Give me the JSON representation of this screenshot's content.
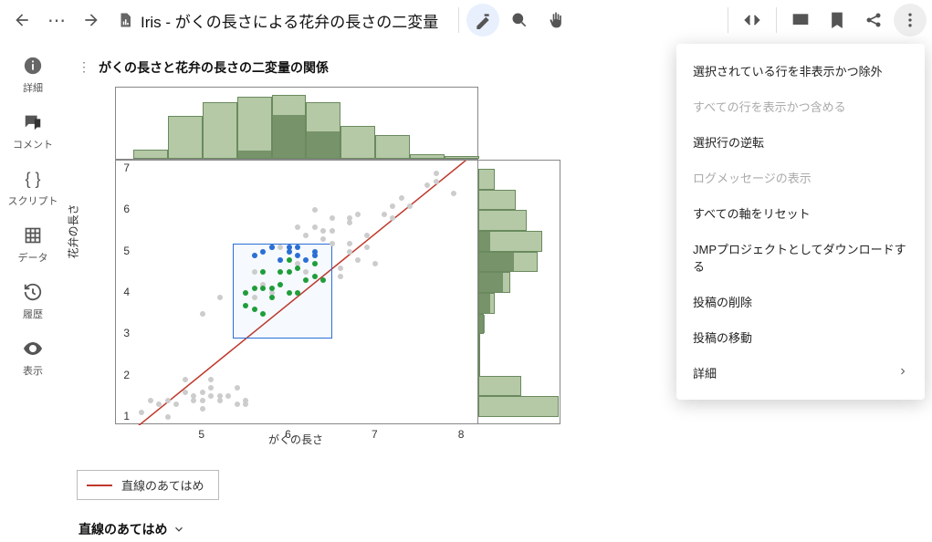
{
  "header": {
    "doc_title": "Iris - がくの長さによる花弁の長さの二変量"
  },
  "sidebar": {
    "items": [
      {
        "label": "詳細"
      },
      {
        "label": "コメント"
      },
      {
        "label": "スクリプト"
      },
      {
        "label": "データ"
      },
      {
        "label": "履歴"
      },
      {
        "label": "表示"
      }
    ]
  },
  "panel": {
    "title": "がくの長さと花弁の長さの二変量の関係",
    "y_label": "花弁の長さ",
    "x_label": "がくの長さ",
    "legend": "直線のあてはめ",
    "fit_section": "直線のあてはめ"
  },
  "menu": {
    "items": [
      {
        "label": "選択されている行を非表示かつ除外",
        "disabled": false
      },
      {
        "label": "すべての行を表示かつ含める",
        "disabled": true
      },
      {
        "label": "選択行の逆転",
        "disabled": false
      },
      {
        "label": "ログメッセージの表示",
        "disabled": true
      },
      {
        "label": "すべての軸をリセット",
        "disabled": false
      },
      {
        "label": "JMPプロジェクトとしてダウンロードする",
        "disabled": false
      },
      {
        "label": "投稿の削除",
        "disabled": false
      },
      {
        "label": "投稿の移動",
        "disabled": false
      },
      {
        "label": "詳細",
        "disabled": false,
        "chevron": true
      }
    ]
  },
  "chart_data": {
    "type": "scatter",
    "title": "がくの長さと花弁の長さの二変量の関係",
    "xlabel": "がくの長さ",
    "ylabel": "花弁の長さ",
    "xlim": [
      4,
      8.2
    ],
    "ylim": [
      0.8,
      7.2
    ],
    "xticks": [
      5,
      6,
      7,
      8
    ],
    "yticks": [
      1,
      2,
      3,
      4,
      5,
      6,
      7
    ],
    "fit_line": {
      "x1": 4.15,
      "y1": 0.6,
      "x2": 8.1,
      "y2": 7.3
    },
    "selection_box": {
      "xmin": 5.35,
      "xmax": 6.5,
      "ymin": 2.9,
      "ymax": 5.2
    },
    "top_histogram": {
      "bin_edges": [
        4.2,
        4.6,
        5.0,
        5.4,
        5.8,
        6.2,
        6.6,
        7.0,
        7.4,
        7.8
      ],
      "counts": [
        4,
        18,
        24,
        26,
        27,
        24,
        14,
        10,
        2,
        1
      ],
      "selected": [
        0,
        0,
        0,
        3,
        18,
        11,
        0,
        0,
        0,
        0
      ],
      "ymax": 30
    },
    "right_histogram": {
      "bin_edges": [
        1.0,
        1.5,
        2.0,
        2.5,
        3.0,
        3.5,
        4.0,
        4.5,
        5.0,
        5.5,
        6.0,
        6.5
      ],
      "counts": [
        30,
        16,
        0,
        0,
        2,
        6,
        12,
        22,
        24,
        18,
        14,
        6
      ],
      "selected": [
        0,
        0,
        0,
        0,
        2,
        4,
        9,
        13,
        4,
        0,
        0,
        0
      ],
      "xmax": 30
    },
    "series": [
      {
        "name": "unselected",
        "color": "#cccccc",
        "x": [
          4.3,
          4.4,
          4.5,
          4.6,
          4.6,
          4.7,
          4.8,
          4.8,
          4.9,
          4.9,
          5.0,
          5.0,
          5.0,
          5.1,
          5.1,
          5.1,
          5.2,
          5.2,
          5.3,
          5.4,
          5.4,
          5.5,
          5.5,
          5.0,
          5.2,
          5.5,
          5.6,
          5.7,
          5.7,
          5.8,
          5.6,
          5.6,
          5.8,
          5.9,
          5.9,
          6.0,
          6.0,
          6.1,
          6.1,
          6.2,
          6.2,
          6.3,
          6.3,
          6.3,
          6.4,
          6.4,
          6.5,
          6.5,
          6.5,
          6.6,
          6.6,
          6.7,
          6.7,
          6.7,
          6.7,
          6.8,
          6.8,
          6.9,
          6.9,
          7.0,
          7.1,
          7.2,
          7.2,
          7.3,
          7.4,
          7.6,
          7.7,
          7.7,
          7.9
        ],
        "y": [
          1.1,
          1.4,
          1.3,
          1.0,
          1.4,
          1.3,
          1.6,
          1.9,
          1.4,
          1.5,
          1.2,
          1.4,
          1.6,
          1.5,
          1.7,
          1.9,
          1.4,
          1.5,
          1.5,
          1.3,
          1.7,
          1.4,
          1.3,
          3.5,
          3.9,
          4.0,
          3.9,
          4.2,
          5.0,
          5.1,
          4.5,
          4.9,
          4.0,
          5.1,
          4.8,
          5.0,
          5.1,
          4.7,
          5.6,
          5.4,
          4.5,
          5.6,
          6.0,
          4.9,
          5.3,
          5.5,
          5.8,
          5.5,
          5.2,
          4.4,
          4.6,
          5.7,
          5.0,
          5.2,
          5.8,
          5.9,
          4.8,
          5.4,
          5.1,
          4.7,
          5.9,
          6.1,
          5.8,
          6.3,
          6.1,
          6.6,
          6.7,
          6.9,
          6.4
        ]
      },
      {
        "name": "selected-green",
        "color": "#1e9e3a",
        "x": [
          5.5,
          5.5,
          5.6,
          5.6,
          5.7,
          5.7,
          5.7,
          5.8,
          5.8,
          5.9,
          5.9,
          6.0,
          6.0,
          6.0,
          6.1,
          6.1,
          6.2,
          6.3,
          6.3,
          6.4
        ],
        "y": [
          3.7,
          4.0,
          3.6,
          4.1,
          3.5,
          4.1,
          4.5,
          3.9,
          4.1,
          4.2,
          4.5,
          4.0,
          4.5,
          4.8,
          4.0,
          4.6,
          4.3,
          4.4,
          4.7,
          4.3
        ]
      },
      {
        "name": "selected-blue",
        "color": "#2a6fd6",
        "x": [
          5.6,
          5.7,
          5.8,
          5.9,
          6.0,
          6.1,
          6.2,
          6.3,
          6.0,
          5.8,
          6.1,
          6.3
        ],
        "y": [
          4.9,
          5.0,
          5.1,
          4.8,
          5.0,
          4.9,
          4.8,
          5.0,
          5.1,
          5.1,
          5.1,
          4.9
        ]
      }
    ]
  }
}
